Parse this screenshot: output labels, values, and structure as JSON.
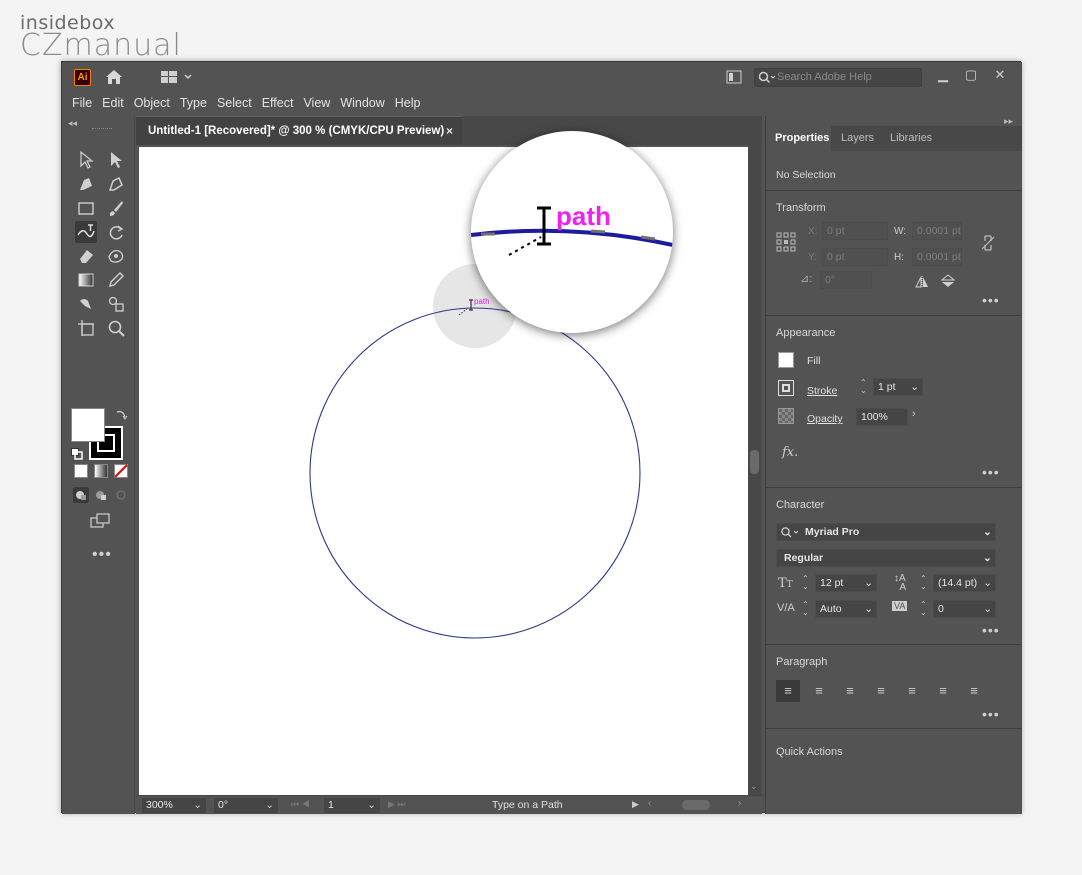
{
  "brand": {
    "line1": "insidebox",
    "line2": "CZmanual"
  },
  "titlebar": {
    "app_badge": "Ai",
    "search_placeholder": "Search Adobe Help",
    "minimize": "▁",
    "restore": "▢",
    "close": "✕"
  },
  "menu": [
    "File",
    "Edit",
    "Object",
    "Type",
    "Select",
    "Effect",
    "View",
    "Window",
    "Help"
  ],
  "document": {
    "tab_title": "Untitled-1 [Recovered]* @ 300 % (CMYK/CPU Preview)",
    "tab_close": "×",
    "cursor_label": "path"
  },
  "status": {
    "zoom": "300%",
    "rotation": "0°",
    "artboard": "1",
    "tool": "Type on a Path"
  },
  "panel": {
    "tabs": [
      "Properties",
      "Layers",
      "Libraries"
    ],
    "selection": "No Selection",
    "transform": {
      "title": "Transform",
      "x_label": "X:",
      "x_value": "0 pt",
      "y_label": "Y:",
      "y_value": "0 pt",
      "w_label": "W:",
      "w_value": "0.0001 pt",
      "h_label": "H:",
      "h_value": "0.0001 pt",
      "angle_value": "0°"
    },
    "appearance": {
      "title": "Appearance",
      "fill_label": "Fill",
      "stroke_label": "Stroke",
      "stroke_value": "1 pt",
      "opacity_label": "Opacity",
      "opacity_value": "100%",
      "fx_label": "fx."
    },
    "character": {
      "title": "Character",
      "font": "Myriad Pro",
      "style": "Regular",
      "size": "12 pt",
      "leading": "(14.4 pt)",
      "kerning": "Auto",
      "tracking": "0"
    },
    "paragraph": {
      "title": "Paragraph"
    },
    "quick_actions": {
      "title": "Quick Actions"
    }
  },
  "colors": {
    "accent_path": "#e020e0",
    "ui_bg": "#535353"
  }
}
